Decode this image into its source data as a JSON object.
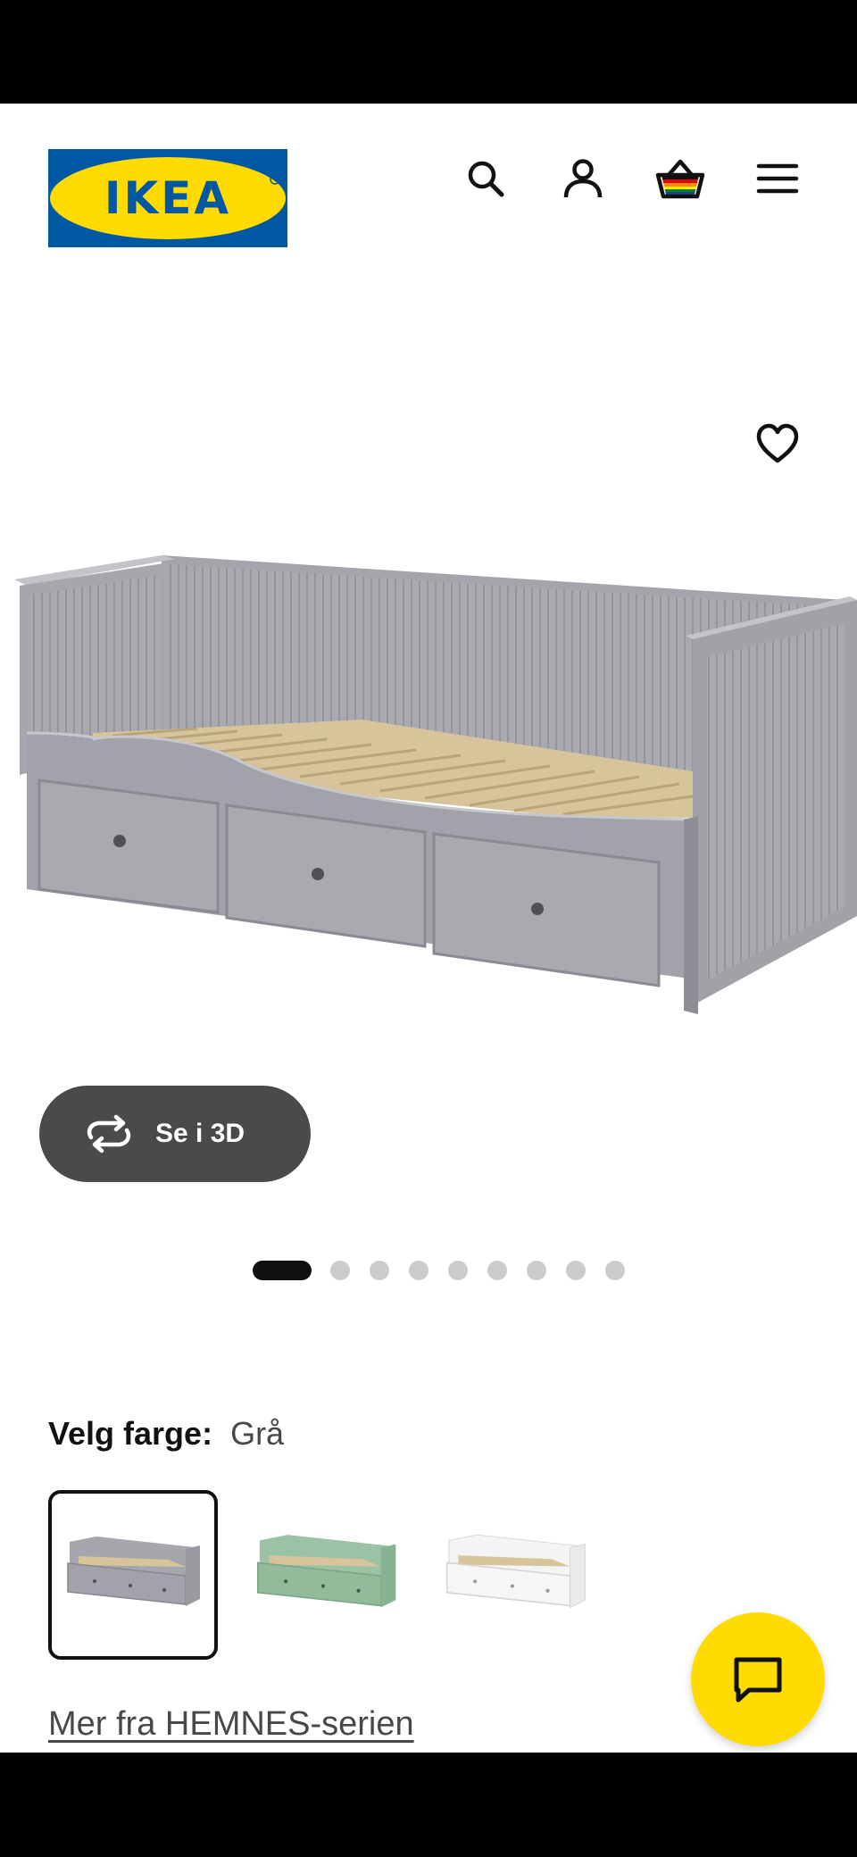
{
  "header": {
    "logo_text": "IKEA",
    "icons": [
      "search-icon",
      "user-icon",
      "basket-icon",
      "menu-icon"
    ]
  },
  "gallery": {
    "favorite_icon": "heart-icon",
    "view_3d_label": "Se i 3D",
    "image_count": 9,
    "active_image": 1
  },
  "color_selector": {
    "label": "Velg farge:",
    "value": "Grå",
    "options": [
      "grey",
      "green",
      "white"
    ],
    "selected": 0
  },
  "series_link": "Mer fra HEMNES-serien",
  "colors": {
    "ikea_blue": "#0058A3",
    "ikea_yellow": "#FFDB00",
    "product_grey": "#A7A7AE",
    "button_dark": "#4A4A4A"
  }
}
